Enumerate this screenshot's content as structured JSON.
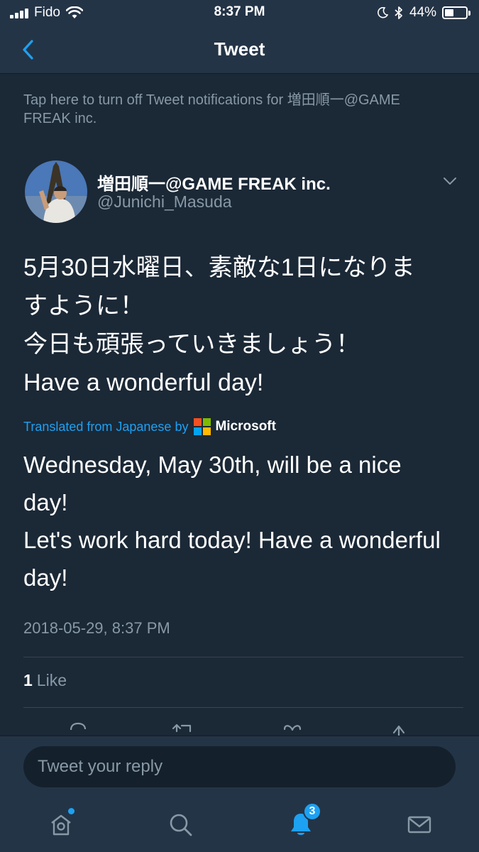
{
  "status_bar": {
    "carrier": "Fido",
    "time": "8:37 PM",
    "battery_percent": "44%",
    "battery_level": 0.44
  },
  "nav": {
    "title": "Tweet",
    "back_icon": "chevron-left-icon"
  },
  "notification_banner": "Tap here to turn off Tweet notifications for 増田順一@GAME FREAK inc.",
  "tweet": {
    "author_name": "増田順一@GAME FREAK inc.",
    "author_handle": "@Junichi_Masuda",
    "text_lines": [
      "5月30日水曜日、素敵な1日になりま",
      "すように！",
      "今日も頑張っていきましょう！",
      "Have a wonderful day!"
    ],
    "translated_label": "Translated from Japanese by",
    "translator": "Microsoft",
    "translation_lines": [
      "Wednesday, May 30th, will be a nice",
      "day!",
      "Let's work hard today! Have a wonderful",
      "day!"
    ],
    "timestamp": "2018-05-29, 8:37 PM",
    "likes_count": "1",
    "likes_label": "Like"
  },
  "reply": {
    "placeholder": "Tweet your reply"
  },
  "tab_bar": {
    "notifications_badge": "3"
  },
  "colors": {
    "background": "#1b2836",
    "bar": "#243447",
    "accent": "#1da1f2",
    "muted_text": "#8899a6"
  }
}
